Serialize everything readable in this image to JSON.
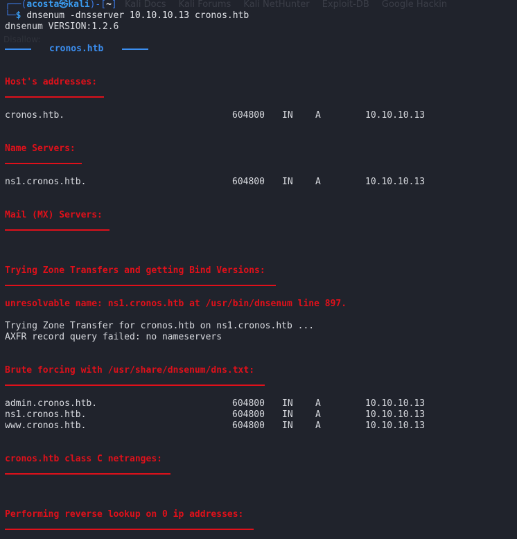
{
  "browser_bar": {
    "bookmarks": [
      "Kali Docs",
      "Kali Forums",
      "Kali NetHunter",
      "Exploit-DB",
      "Google Hackin"
    ],
    "faded_text": "Disallow:"
  },
  "prompt": {
    "user": "acosta",
    "host": "kali",
    "dir": "~",
    "command": "dnsenum -dnsserver 10.10.10.13 cronos.htb"
  },
  "version": "dnsenum VERSION:1.2.6",
  "domain_banner": "cronos.htb",
  "sections": {
    "hosts": {
      "title": "Host's addresses:",
      "records": [
        {
          "name": "cronos.htb.",
          "ttl": "604800",
          "class": "IN",
          "type": "A",
          "value": "10.10.10.13"
        }
      ]
    },
    "ns": {
      "title": "Name Servers:",
      "records": [
        {
          "name": "ns1.cronos.htb.",
          "ttl": "604800",
          "class": "IN",
          "type": "A",
          "value": "10.10.10.13"
        }
      ]
    },
    "mx": {
      "title": "Mail (MX) Servers:"
    },
    "zone": {
      "title": "Trying Zone Transfers and getting Bind Versions:",
      "error": "unresolvable name: ns1.cronos.htb at /usr/bin/dnsenum line 897.",
      "line1": "Trying Zone Transfer for cronos.htb on ns1.cronos.htb ...",
      "line2": "AXFR record query failed: no nameservers"
    },
    "brute": {
      "title": "Brute forcing with /usr/share/dnsenum/dns.txt:",
      "records": [
        {
          "name": "admin.cronos.htb.",
          "ttl": "604800",
          "class": "IN",
          "type": "A",
          "value": "10.10.10.13"
        },
        {
          "name": "ns1.cronos.htb.",
          "ttl": "604800",
          "class": "IN",
          "type": "A",
          "value": "10.10.10.13"
        },
        {
          "name": "www.cronos.htb.",
          "ttl": "604800",
          "class": "IN",
          "type": "A",
          "value": "10.10.10.13"
        }
      ]
    },
    "netranges": {
      "title": "cronos.htb class C netranges:"
    },
    "reverse": {
      "title": "Performing reverse lookup on 0 ip addresses:"
    }
  }
}
